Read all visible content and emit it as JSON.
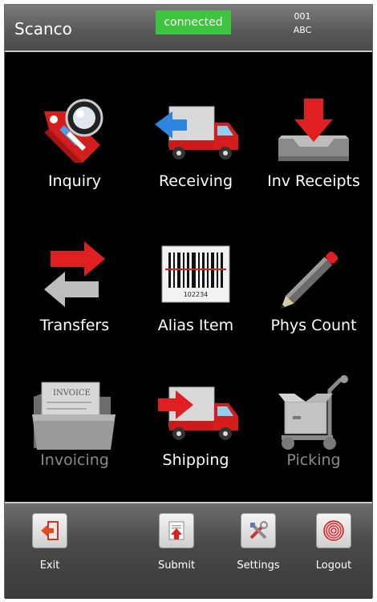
{
  "header": {
    "app_name": "Scanco",
    "status": "connected",
    "code_line1": "001",
    "code_line2": "ABC"
  },
  "tiles": [
    {
      "label": "Inquiry",
      "icon": "inquiry-icon",
      "enabled": true
    },
    {
      "label": "Receiving",
      "icon": "receiving-truck-icon",
      "enabled": true
    },
    {
      "label": "Inv Receipts",
      "icon": "inventory-receipt-icon",
      "enabled": true
    },
    {
      "label": "Transfers",
      "icon": "transfer-arrows-icon",
      "enabled": true
    },
    {
      "label": "Alias Item",
      "icon": "barcode-icon",
      "enabled": true
    },
    {
      "label": "Phys Count",
      "icon": "pencil-icon",
      "enabled": true
    },
    {
      "label": "Invoicing",
      "icon": "invoice-folder-icon",
      "enabled": false
    },
    {
      "label": "Shipping",
      "icon": "shipping-truck-icon",
      "enabled": true
    },
    {
      "label": "Picking",
      "icon": "hand-truck-icon",
      "enabled": false
    }
  ],
  "barcode_text": "102234",
  "invoice_text": "INVOICE",
  "bottom": [
    {
      "label": "Exit",
      "icon": "exit-door-icon"
    },
    {
      "label": "Submit",
      "icon": "submit-upload-icon"
    },
    {
      "label": "Settings",
      "icon": "settings-tools-icon"
    },
    {
      "label": "Logout",
      "icon": "fingerprint-icon"
    }
  ],
  "colors": {
    "status_green": "#3ec43e",
    "accent_red": "#e02020",
    "accent_blue": "#2f86e0",
    "disabled_text": "#8a8a8a"
  }
}
